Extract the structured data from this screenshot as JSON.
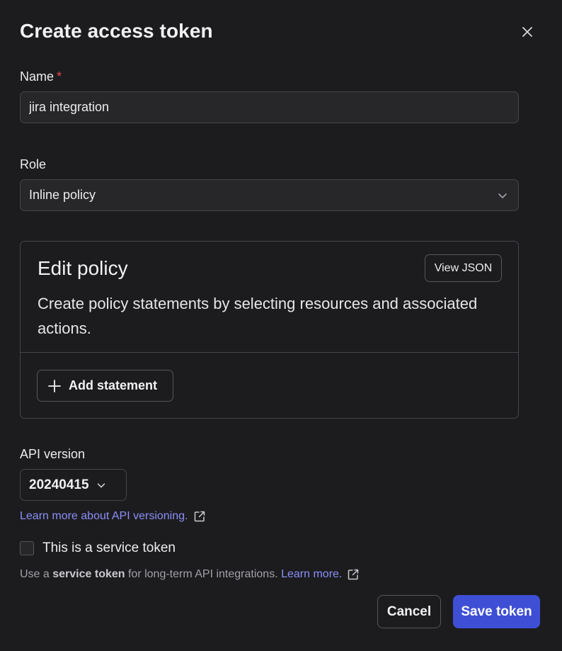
{
  "dialog": {
    "title": "Create access token",
    "close_icon": "close-icon"
  },
  "name_field": {
    "label": "Name",
    "required_marker": "*",
    "value": "jira integration"
  },
  "role_field": {
    "label": "Role",
    "selected": "Inline policy",
    "icon": "chevron-down-icon"
  },
  "policy": {
    "title": "Edit policy",
    "view_json_label": "View JSON",
    "description": "Create policy statements by selecting resources and associated actions.",
    "add_statement_label": "Add statement",
    "add_icon": "plus-icon"
  },
  "api_version": {
    "label": "API version",
    "selected": "20240415",
    "learn_more_link": "Learn more about API versioning.",
    "link_icon": "external-link-icon"
  },
  "service_token": {
    "checkbox_label": "This is a service token",
    "checked": false,
    "help_prefix": "Use a",
    "help_bold": "service token",
    "help_suffix": "for long-term API integrations.",
    "help_link": "Learn more."
  },
  "footer": {
    "cancel_label": "Cancel",
    "save_label": "Save token"
  },
  "colors": {
    "background": "#1c1c1f",
    "accent": "#3e4fd6",
    "link": "#8b8ff7",
    "required": "#e5484d"
  }
}
